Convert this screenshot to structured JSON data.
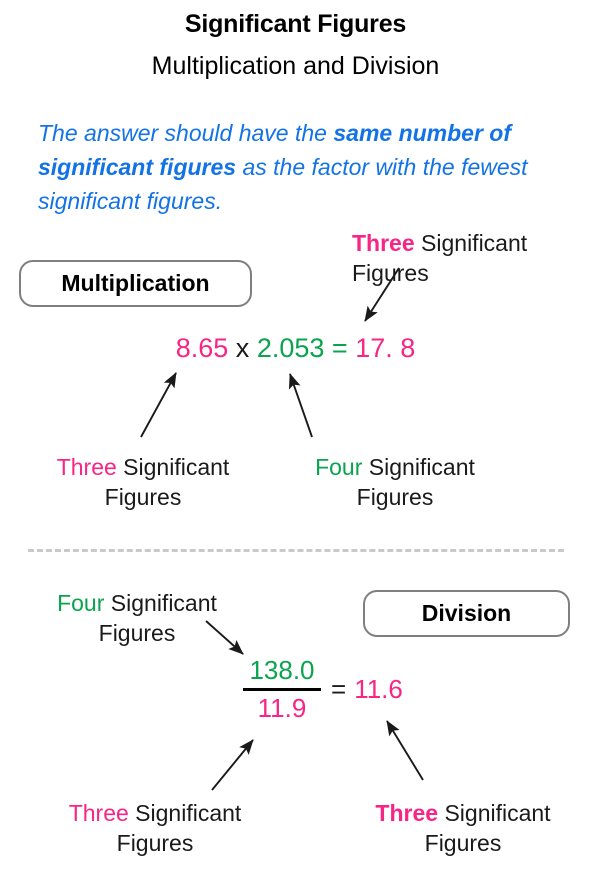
{
  "page": {
    "title": "Significant Figures",
    "subtitle": "Multiplication and Division",
    "rule_part1": "The answer should have the ",
    "rule_bold": "same number of significant figures",
    "rule_part2": " as the factor with the fewest significant figures."
  },
  "colors": {
    "pink": "#f72585",
    "green": "#0aa44f",
    "blue": "#1373e6",
    "black": "#1a1a1a",
    "divider_gray": "#c9c9c9",
    "pill_border": "#7f7f7f"
  },
  "multiplication": {
    "pill_label": "Multiplication",
    "equation": {
      "factor1": "8.65",
      "operator": "x",
      "factor2": "2.053",
      "equals": "=",
      "result": "17. 8"
    },
    "caption_result": {
      "count": "Three",
      "rest": " Significant Figures"
    },
    "caption_factor1": {
      "count": "Three",
      "rest": " Significant Figures"
    },
    "caption_factor2": {
      "count": "Four",
      "rest": " Significant Figures"
    }
  },
  "division": {
    "pill_label": "Division",
    "fraction": {
      "numerator": "138.0",
      "denominator": "11.9",
      "equals": "=",
      "quotient": "11.6"
    },
    "caption_numerator": {
      "count": "Four",
      "rest": " Significant Figures"
    },
    "caption_denominator": {
      "count": "Three",
      "rest": " Significant Figures"
    },
    "caption_quotient": {
      "count": "Three",
      "rest": " Significant Figures"
    }
  }
}
